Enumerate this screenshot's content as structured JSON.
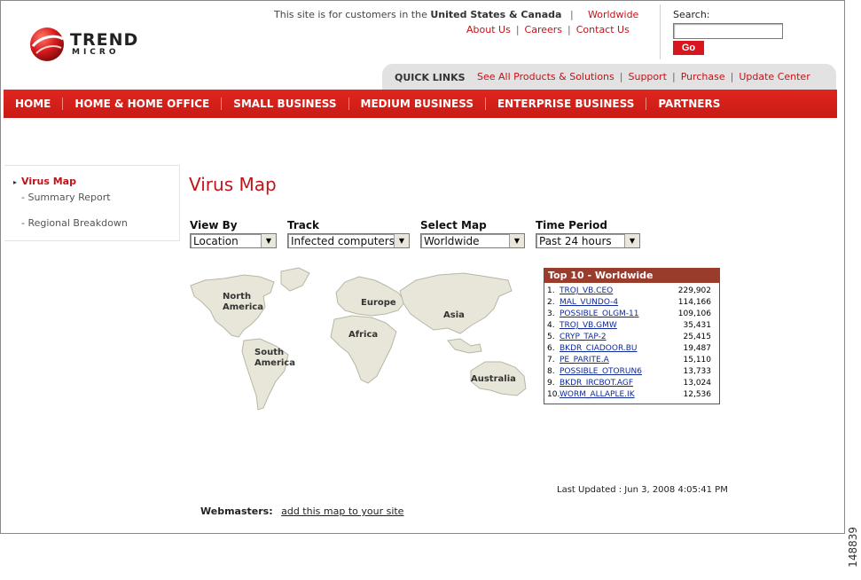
{
  "brand": {
    "logo_line1": "TREND",
    "logo_line2": "MICRO",
    "red": "#d5221c"
  },
  "header": {
    "region_text_prefix": "This site is for customers in the",
    "region_text_bold": "United States & Canada",
    "worldwide": "Worldwide",
    "links": [
      "About Us",
      "Careers",
      "Contact Us"
    ]
  },
  "search": {
    "label": "Search:",
    "value": "",
    "button": "Go"
  },
  "quick_links": {
    "title": "QUICK LINKS",
    "items": [
      "See All Products & Solutions",
      "Support",
      "Purchase",
      "Update Center"
    ]
  },
  "nav": [
    "HOME",
    "HOME & HOME OFFICE",
    "SMALL BUSINESS",
    "MEDIUM BUSINESS",
    "ENTERPRISE BUSINESS",
    "PARTNERS"
  ],
  "left_menu": {
    "active": "Virus Map",
    "items": [
      "Summary Report",
      "Regional Breakdown"
    ]
  },
  "page_title": "Virus Map",
  "selectors": [
    {
      "label": "View By",
      "value": "Location"
    },
    {
      "label": "Track",
      "value": "Infected computers"
    },
    {
      "label": "Select Map",
      "value": "Worldwide"
    },
    {
      "label": "Time Period",
      "value": "Past 24 hours"
    }
  ],
  "map_labels": {
    "north_america": [
      "North",
      "America"
    ],
    "south_america": [
      "South",
      "America"
    ],
    "europe": "Europe",
    "africa": "Africa",
    "asia": "Asia",
    "australia": "Australia"
  },
  "top10": {
    "title": "Top 10 - Worldwide",
    "rows": [
      {
        "rank": "1.",
        "name": "TROJ_VB.CEO",
        "count": "229,902"
      },
      {
        "rank": "2.",
        "name": "MAL_VUNDO-4",
        "count": "114,166"
      },
      {
        "rank": "3.",
        "name": "POSSIBLE_OLGM-11",
        "count": "109,106"
      },
      {
        "rank": "4.",
        "name": "TROJ_VB.GMW",
        "count": "35,431"
      },
      {
        "rank": "5.",
        "name": "CRYP_TAP-2",
        "count": "25,415"
      },
      {
        "rank": "6.",
        "name": "BKDR_CIADOOR.BU",
        "count": "19,487"
      },
      {
        "rank": "7.",
        "name": "PE_PARITE.A",
        "count": "15,110"
      },
      {
        "rank": "8.",
        "name": "POSSIBLE_OTORUN6",
        "count": "13,733"
      },
      {
        "rank": "9.",
        "name": "BKDR_IRCBOT.AGF",
        "count": "13,024"
      },
      {
        "rank": "10.",
        "name": "WORM_ALLAPLE.IK",
        "count": "12,536"
      }
    ]
  },
  "last_updated": "Last Updated : Jun 3, 2008 4:05:41 PM",
  "webmasters": {
    "label": "Webmasters:",
    "link": "add this map to your site"
  },
  "figure_id": "148839"
}
